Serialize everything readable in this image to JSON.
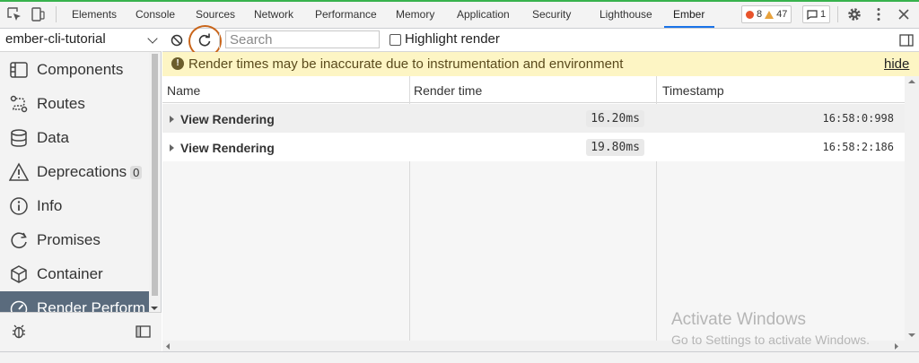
{
  "devtools": {
    "tabs": [
      "Elements",
      "Console",
      "Sources",
      "Network",
      "Performance",
      "Memory",
      "Application",
      "Security",
      "Lighthouse",
      "Ember"
    ],
    "active_tab": "Ember",
    "errors_count": "8",
    "warnings_count": "47",
    "messages_count": "1"
  },
  "sidebar": {
    "app_name": "ember-cli-tutorial",
    "items": [
      {
        "label": "Components",
        "icon": "components-icon"
      },
      {
        "label": "Routes",
        "icon": "routes-icon"
      },
      {
        "label": "Data",
        "icon": "database-icon"
      },
      {
        "label": "Deprecations",
        "icon": "warning-icon",
        "badge": "0"
      },
      {
        "label": "Info",
        "icon": "info-icon"
      },
      {
        "label": "Promises",
        "icon": "promises-icon"
      },
      {
        "label": "Container",
        "icon": "cube-icon"
      },
      {
        "label": "Render Perform",
        "icon": "gauge-icon",
        "active": true
      }
    ]
  },
  "toolbar": {
    "search_placeholder": "Search",
    "highlight_label": "Highlight render"
  },
  "warning": {
    "text": "Render times may be inaccurate due to instrumentation and environment",
    "hide_label": "hide"
  },
  "table": {
    "headers": [
      "Name",
      "Render time",
      "Timestamp"
    ],
    "rows": [
      {
        "name": "View Rendering",
        "render_time": "16.20ms",
        "timestamp": "16:58:0:998"
      },
      {
        "name": "View Rendering",
        "render_time": "19.80ms",
        "timestamp": "16:58:2:186"
      }
    ]
  },
  "watermark": {
    "line1": "Activate Windows",
    "line2": "Go to Settings to activate Windows."
  },
  "colors": {
    "accent": "#1a73e8",
    "active_nav": "#5a6b7d",
    "warning_bg": "#fdf5c4",
    "annotation": "#c9651a"
  }
}
